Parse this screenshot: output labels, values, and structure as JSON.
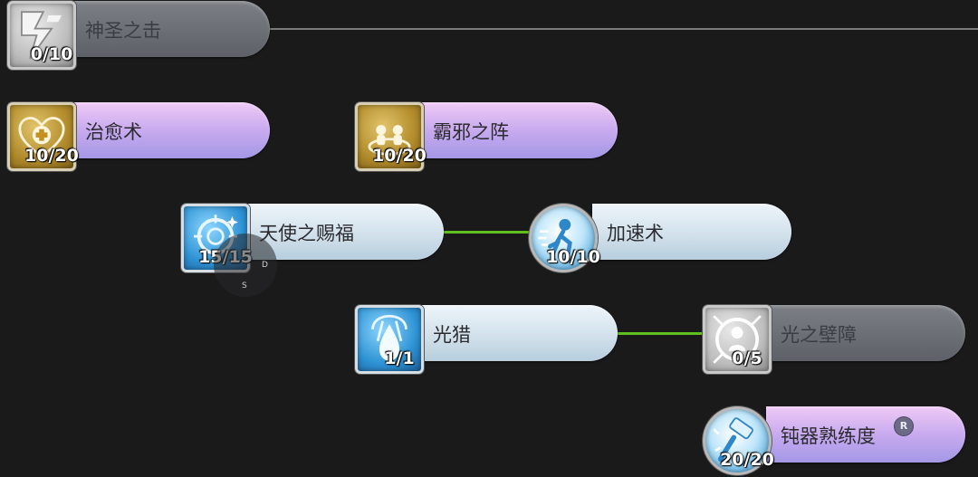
{
  "skills": [
    {
      "name": "神圣之击",
      "level": "0/10",
      "icon": "holy-strike-icon",
      "style": "gray"
    },
    {
      "name": "治愈术",
      "level": "10/20",
      "icon": "heal-heart-icon",
      "style": "purple"
    },
    {
      "name": "霸邪之阵",
      "level": "10/20",
      "icon": "ward-formation-icon",
      "style": "purple"
    },
    {
      "name": "天使之赐福",
      "level": "15/15",
      "icon": "angel-blessing-icon",
      "style": "light"
    },
    {
      "name": "加速术",
      "level": "10/10",
      "icon": "haste-runner-icon",
      "style": "light"
    },
    {
      "name": "光猎",
      "level": "1/1",
      "icon": "light-hunt-icon",
      "style": "light"
    },
    {
      "name": "光之壁障",
      "level": "0/5",
      "icon": "light-barrier-icon",
      "style": "gray"
    },
    {
      "name": "钝器熟练度",
      "level": "20/20",
      "icon": "blunt-mastery-icon",
      "style": "purple",
      "badge": "R"
    }
  ],
  "joystick": {
    "labels": [
      "D",
      "S"
    ]
  },
  "colors": {
    "background": "#1a1a1b",
    "connector_active": "#5fbf1f",
    "connector_inactive": "#7a7a7c",
    "pill_purple": "#c4a8ee",
    "pill_light": "#cfdfea",
    "pill_gray": "#6a6e74"
  }
}
